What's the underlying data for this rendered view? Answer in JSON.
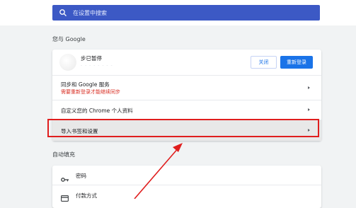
{
  "search": {
    "placeholder": "在设置中搜索"
  },
  "section_you_google": {
    "title": "您与 Google"
  },
  "account": {
    "status": "步已暂停",
    "sub_text": "- - - - - - - -"
  },
  "buttons": {
    "close": "关闭",
    "relogin": "重新登录"
  },
  "rows": {
    "sync": {
      "label": "同步和 Google 服务",
      "sublabel": "需要重新登录才能继续同步"
    },
    "customize": {
      "label": "自定义您的 Chrome 个人资料"
    },
    "import": {
      "label": "导入书签和设置"
    }
  },
  "section_autofill": {
    "title": "自动填充"
  },
  "autofill": {
    "passwords": "密码",
    "payment": "付款方式"
  },
  "colors": {
    "accent": "#1a73e8",
    "search_bg": "#3c59c5",
    "warning_red": "#d93025",
    "annotation_red": "#e01e1e"
  }
}
